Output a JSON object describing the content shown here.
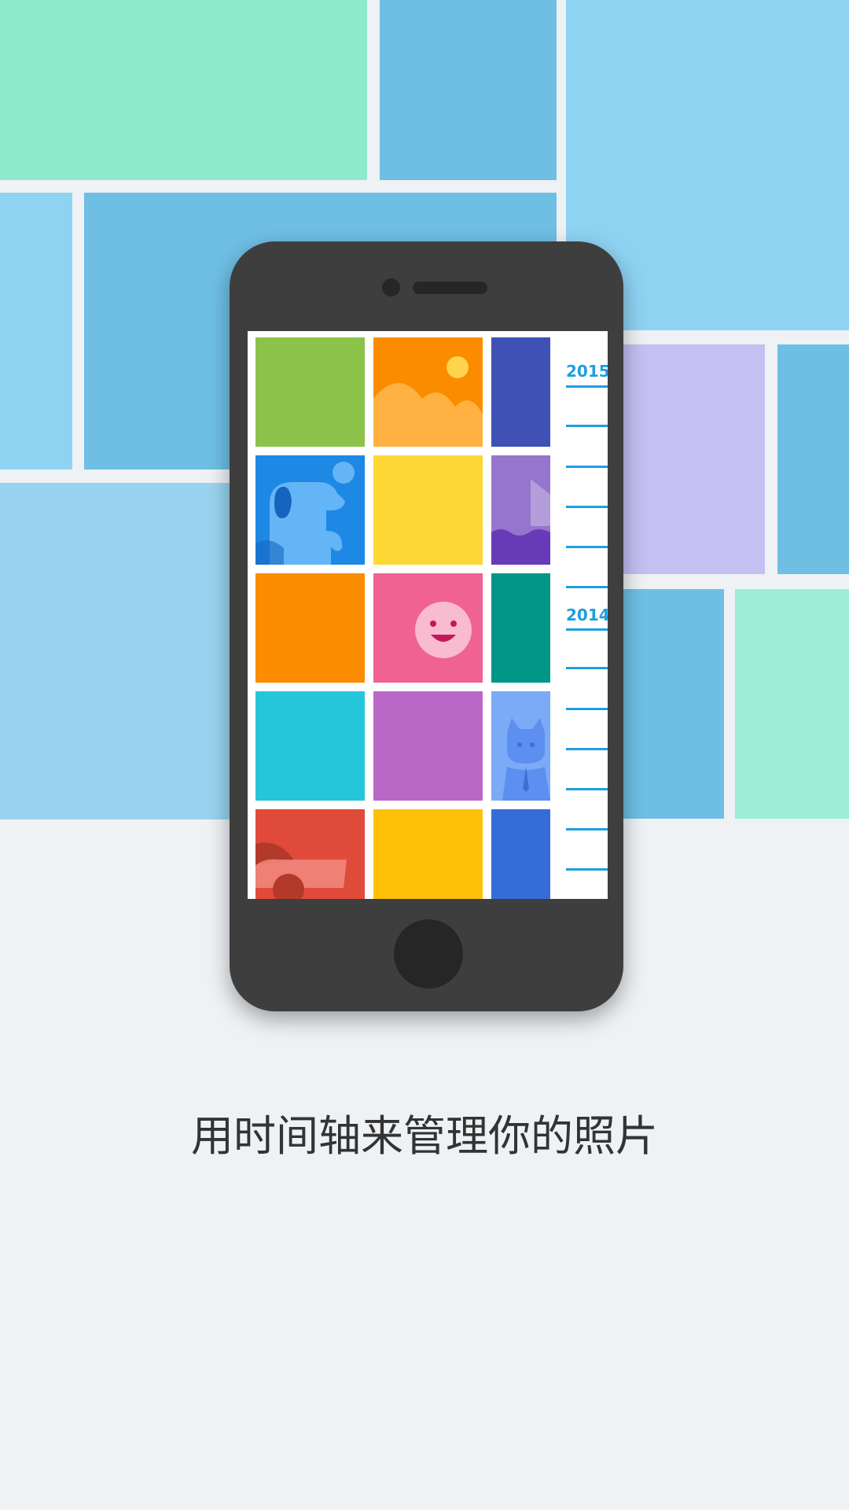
{
  "caption": "用时间轴来管理你的照片",
  "timeline": {
    "years": [
      "2015",
      "2014"
    ],
    "accent_color": "#1e9ee0"
  },
  "photo_grid": {
    "tiles": [
      {
        "color": "#8bc34a",
        "icon": "none"
      },
      {
        "color": "#fb8c00",
        "icon": "landscape-icon"
      },
      {
        "color": "#3f51b5",
        "icon": "none"
      },
      {
        "color": "#1e88e5",
        "icon": "dog-icon"
      },
      {
        "color": "#fdd835",
        "icon": "none"
      },
      {
        "color": "#9575cd",
        "icon": "boat-icon"
      },
      {
        "color": "#fb8c00",
        "icon": "none"
      },
      {
        "color": "#f06292",
        "icon": "smiley-icon"
      },
      {
        "color": "#009688",
        "icon": "none"
      },
      {
        "color": "#26c6da",
        "icon": "none"
      },
      {
        "color": "#ba68c8",
        "icon": "none"
      },
      {
        "color": "#7baaf7",
        "icon": "cat-icon"
      },
      {
        "color": "#e04a3a",
        "icon": "car-icon"
      },
      {
        "color": "#ffc107",
        "icon": "none"
      },
      {
        "color": "#356cd8",
        "icon": "none"
      }
    ]
  },
  "background": {
    "colors": [
      "#8fe9cb",
      "#6fbfe4",
      "#8fd3f3",
      "#c5bff2",
      "#9ad3ef"
    ]
  }
}
